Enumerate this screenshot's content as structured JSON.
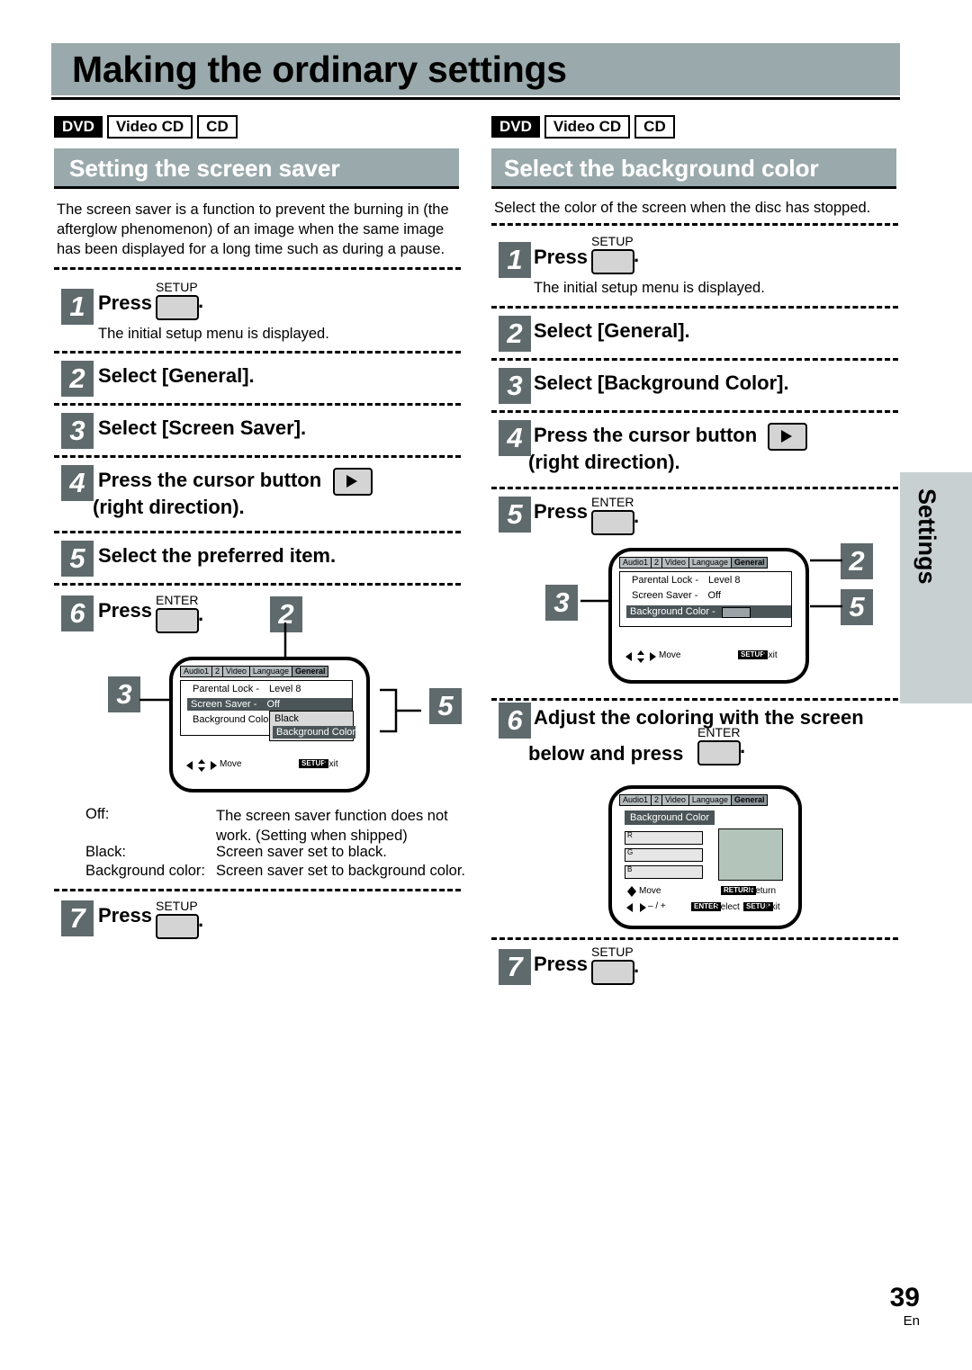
{
  "page": {
    "title": "Making the ordinary settings",
    "number": "39",
    "lang": "En",
    "side_tab": "Settings"
  },
  "badges": [
    "DVD",
    "Video CD",
    "CD"
  ],
  "left": {
    "heading": "Setting the screen saver",
    "intro": "The screen saver is a function to prevent the burning in (the afterglow phenomenon) of an image when the same image has been displayed for a long time such as during a pause.",
    "steps": [
      {
        "n": "1",
        "text": "Press",
        "key": "SETUP",
        "note": "The initial setup menu is displayed."
      },
      {
        "n": "2",
        "text": "Select [General]."
      },
      {
        "n": "3",
        "text": "Select [Screen Saver]."
      },
      {
        "n": "4",
        "text": "Press the cursor button",
        "text2": "(right direction)."
      },
      {
        "n": "5",
        "text": "Select the preferred item."
      },
      {
        "n": "6",
        "text": "Press",
        "key": "ENTER"
      },
      {
        "n": "7",
        "text": "Press",
        "key": "SETUP"
      }
    ],
    "options": [
      {
        "label": "Off:",
        "desc": "The screen saver function does not work. (Setting when shipped)"
      },
      {
        "label": "Black:",
        "desc": "Screen saver set to black."
      },
      {
        "label": "Background color:",
        "desc": "Screen saver set to background color."
      }
    ],
    "osd": {
      "tabs": [
        "Audio1",
        "2",
        "Video",
        "Language",
        "General"
      ],
      "selected_tab": "General",
      "rows": [
        {
          "label": "Parental Lock -",
          "value": "Level 8"
        },
        {
          "label": "Screen Saver -",
          "value": "Off",
          "selected": true
        },
        {
          "label": "Background Color -",
          "value": "Black"
        }
      ],
      "dropdown": [
        "Black",
        "Background Color"
      ],
      "footer_move": "Move",
      "footer_exit_key": "SETUP",
      "footer_exit": "Exit"
    },
    "callouts": [
      "3",
      "2",
      "5"
    ]
  },
  "right": {
    "heading": "Select the background color",
    "intro": "Select the color of the screen when the disc has stopped.",
    "steps": [
      {
        "n": "1",
        "text": "Press",
        "key": "SETUP",
        "note": "The initial setup menu is displayed."
      },
      {
        "n": "2",
        "text": "Select [General]."
      },
      {
        "n": "3",
        "text": "Select [Background Color]."
      },
      {
        "n": "4",
        "text": "Press the cursor button",
        "text2": "(right direction)."
      },
      {
        "n": "5",
        "text": "Press",
        "key": "ENTER"
      },
      {
        "n": "6",
        "text": "Adjust the coloring with the screen",
        "text2": "below and press",
        "key": "ENTER"
      },
      {
        "n": "7",
        "text": "Press",
        "key": "SETUP"
      }
    ],
    "osd1": {
      "tabs": [
        "Audio1",
        "2",
        "Video",
        "Language",
        "General"
      ],
      "selected_tab": "General",
      "rows": [
        {
          "label": "Parental Lock -",
          "value": "Level 8"
        },
        {
          "label": "Screen Saver -",
          "value": "Off"
        },
        {
          "label": "Background Color -",
          "value": "",
          "selected": true
        }
      ],
      "footer_move": "Move",
      "footer_exit_key": "SETUP",
      "footer_exit": "Exit"
    },
    "osd2": {
      "tabs": [
        "Audio1",
        "2",
        "Video",
        "Language",
        "General"
      ],
      "selected_tab": "General",
      "title": "Background Color",
      "sliders": [
        "R",
        "G",
        "B"
      ],
      "footer_move": "Move",
      "footer_adjust": "– / +",
      "footer_return_key": "RETURN",
      "footer_return": "Return",
      "footer_select_key": "ENTER",
      "footer_select": "Select",
      "footer_exit_key": "SETUP",
      "footer_exit": "Exit"
    },
    "callouts": [
      "3",
      "2",
      "5"
    ]
  }
}
